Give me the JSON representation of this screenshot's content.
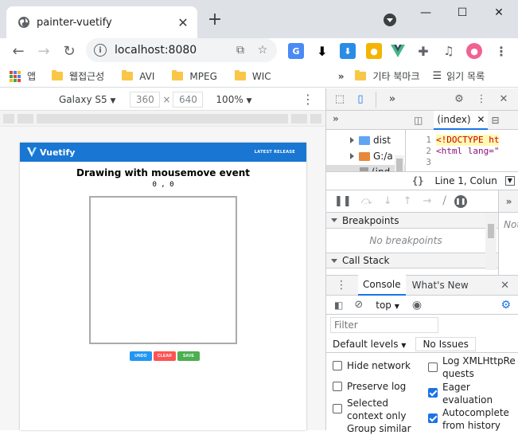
{
  "browser": {
    "tab_title": "painter-vuetify",
    "url": "localhost:8080",
    "bookmarks": [
      "앱",
      "웹접근성",
      "AVI",
      "MPEG",
      "WIC"
    ],
    "bookmarks_more": "»",
    "other_bookmarks": "기타 북마크",
    "reading_list": "읽기 목록"
  },
  "device_toolbar": {
    "device": "Galaxy S5",
    "width": "360",
    "times": "×",
    "height": "640",
    "zoom": "100%"
  },
  "app": {
    "brand": "Vuetify",
    "release_link": "LATEST RELEASE",
    "heading": "Drawing with mousemove event",
    "coords": "0 , 0",
    "buttons": {
      "undo": "UNDO",
      "clear": "CLEAR",
      "save": "SAVE"
    },
    "colors": {
      "appbar": "#1976d2",
      "undo": "#2196f3",
      "clear": "#ff5252",
      "save": "#4caf50"
    }
  },
  "devtools": {
    "sources_files": [
      "dist",
      "G:/a",
      "(ind"
    ],
    "editor_tab": "(index)",
    "code_lines": [
      {
        "num": "1",
        "text": "<!DOCTYPE ht"
      },
      {
        "num": "2",
        "text": "<html lang=\""
      },
      {
        "num": "3",
        "text": ""
      }
    ],
    "cursor_status": "Line 1, Colun",
    "not_paused_stub": "Not",
    "sections": {
      "breakpoints": "Breakpoints",
      "no_breakpoints": "No breakpoints",
      "call_stack": "Call Stack"
    },
    "console": {
      "tab_console": "Console",
      "tab_whats_new": "What's New",
      "context": "top",
      "filter_placeholder": "Filter",
      "levels": "Default levels",
      "issues": "No Issues",
      "options_left": [
        {
          "label": "Hide network",
          "checked": false
        },
        {
          "label": "Preserve log",
          "checked": false
        },
        {
          "label": "Selected context only",
          "checked": false
        },
        {
          "label": "Group similar",
          "checked": false
        }
      ],
      "options_right": [
        {
          "label": "Log XMLHttpRequests",
          "checked": false
        },
        {
          "label": "Eager evaluation",
          "checked": true
        },
        {
          "label": "Autocomplete from history",
          "checked": true
        }
      ]
    }
  }
}
